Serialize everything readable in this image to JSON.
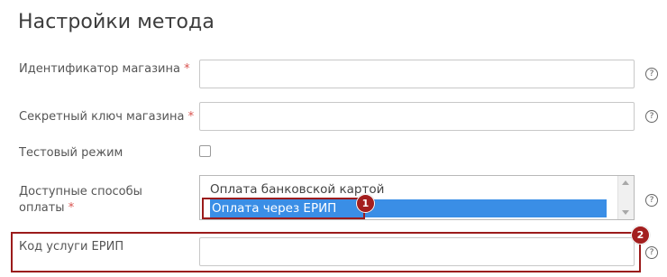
{
  "section": {
    "title": "Настройки метода"
  },
  "fields": {
    "shop_id": {
      "label": "Идентификатор магазина",
      "required_mark": "*",
      "value": "",
      "help": "?"
    },
    "secret_key": {
      "label": "Секретный ключ магазина",
      "required_mark": "*",
      "value": "",
      "help": "?"
    },
    "test_mode": {
      "label": "Тестовый режим",
      "checked": false
    },
    "payment_methods": {
      "label_line1": "Доступные способы",
      "label_line2": "оплаты",
      "required_mark": "*",
      "options": [
        "Оплата банковской картой",
        "Оплата через ЕРИП"
      ],
      "selected": "Оплата через ЕРИП",
      "help": "?"
    },
    "erip_code": {
      "label": "Код услуги ЕРИП",
      "value": "",
      "help": "?"
    }
  },
  "annotations": {
    "badge1": "1",
    "badge2": "2",
    "color": "#a31e1e"
  },
  "colors": {
    "selection": "#3a8ee6",
    "required": "#d9534f"
  }
}
